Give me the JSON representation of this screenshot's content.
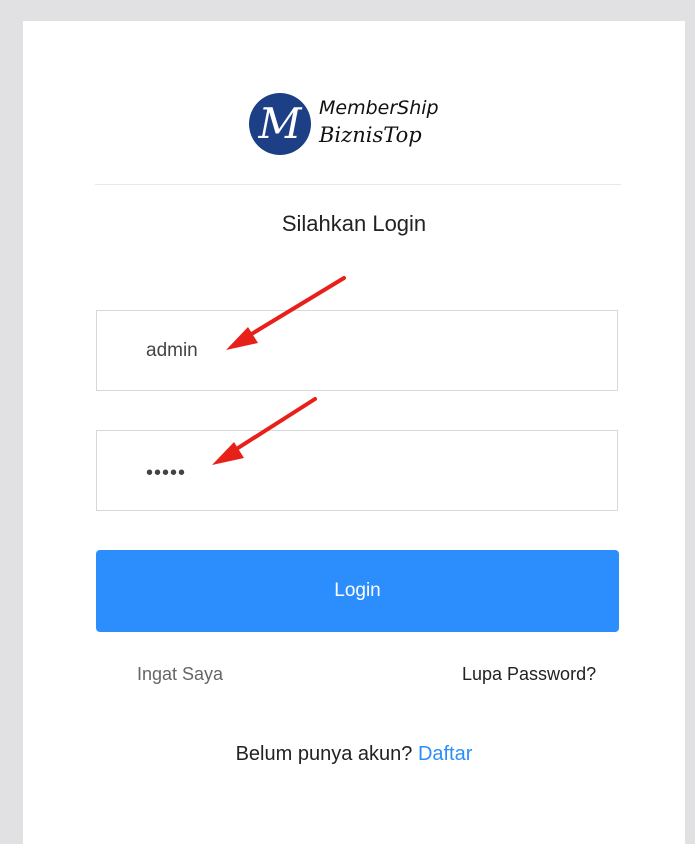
{
  "brand": {
    "logo_letter": "M",
    "line1": "MemberShip",
    "line2": "BiznisTop"
  },
  "page_title": "Silahkan Login",
  "username_field": {
    "value": "admin"
  },
  "password_field": {
    "value": "•••••"
  },
  "login_button": "Login",
  "remember_label": "Ingat Saya",
  "forgot_link": "Lupa Password?",
  "register": {
    "prompt": "Belum punya akun?",
    "link": "Daftar"
  },
  "colors": {
    "primary": "#2c8efc",
    "logo": "#1c3f86",
    "annotation_arrow": "#e8201a"
  },
  "annotations": [
    "arrow-icon",
    "arrow-icon"
  ]
}
